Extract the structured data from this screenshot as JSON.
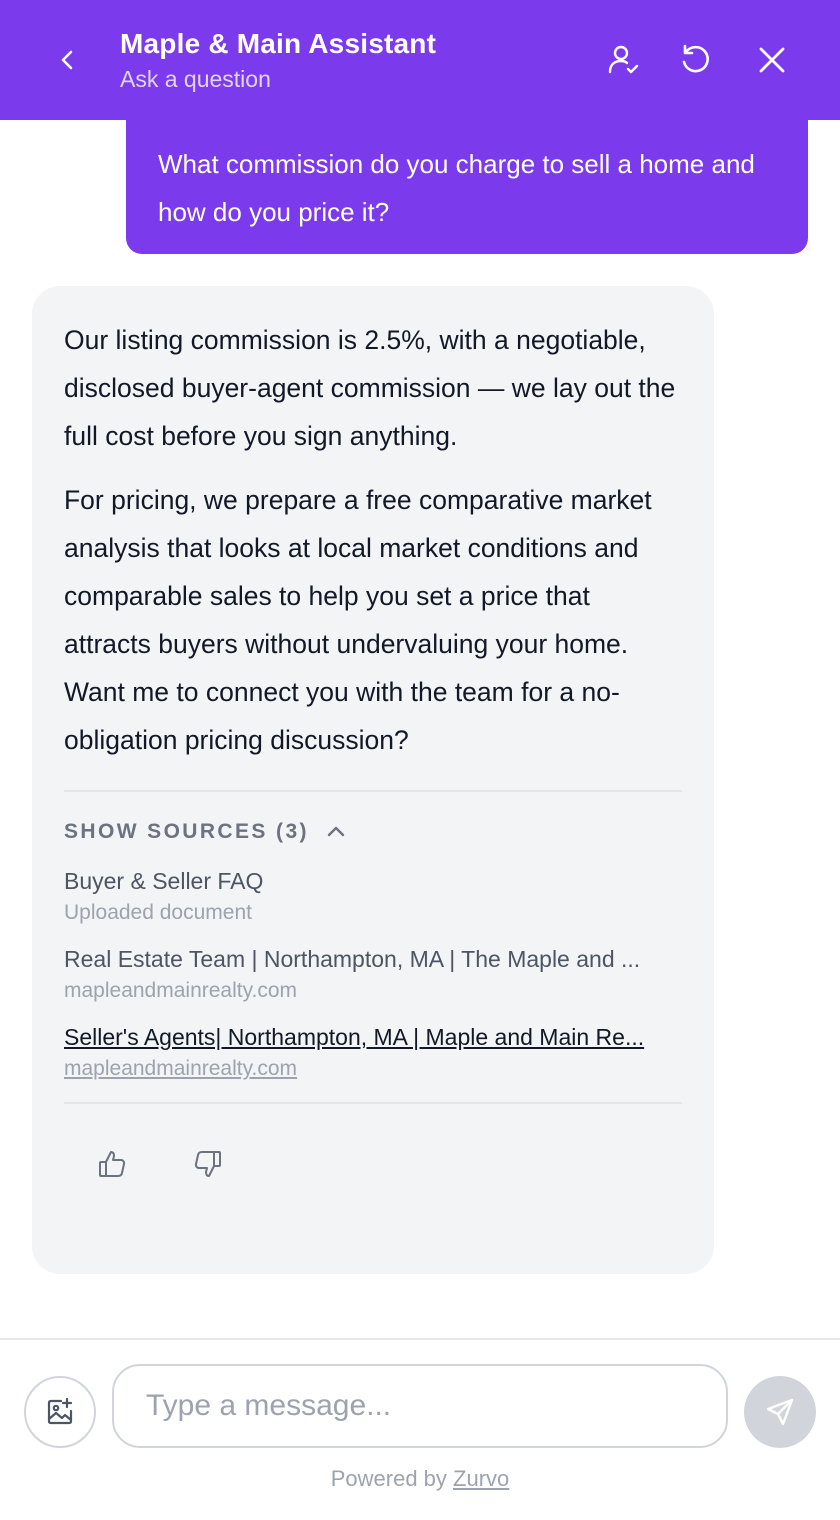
{
  "header": {
    "title": "Maple & Main Assistant",
    "subtitle": "Ask a question",
    "icons": {
      "back": "chevron-left-icon",
      "agent": "user-check-icon",
      "reset": "rotate-ccw-icon",
      "close": "close-icon"
    }
  },
  "user_message": "What commission do you charge to sell a home and how do you price it?",
  "bot_message": {
    "paragraphs": [
      "Our listing commission is 2.5%, with a negotiable, disclosed buyer-agent commission — we lay out the full cost before you sign anything.",
      "For pricing, we prepare a free comparative market analysis that looks at local market conditions and comparable sales to help you set a price that attracts buyers without undervaluing your home. Want me to connect you with the team for a no-obligation pricing discussion?"
    ],
    "sources_label": "SHOW SOURCES (3)",
    "sources": [
      {
        "title": "Buyer & Seller FAQ",
        "subtitle": "Uploaded document"
      },
      {
        "title": "Real Estate Team | Northampton, MA | The Maple and ...",
        "subtitle": "mapleandmainrealty.com"
      },
      {
        "title": "Seller's Agents| Northampton, MA | Maple and Main Re...",
        "subtitle": "mapleandmainrealty.com"
      }
    ]
  },
  "composer": {
    "placeholder": "Type a message...",
    "powered_prefix": "Powered by ",
    "powered_brand": "Zurvo"
  },
  "colors": {
    "brand": "#7c3aed",
    "bubble_bg": "#f2f4f6"
  }
}
